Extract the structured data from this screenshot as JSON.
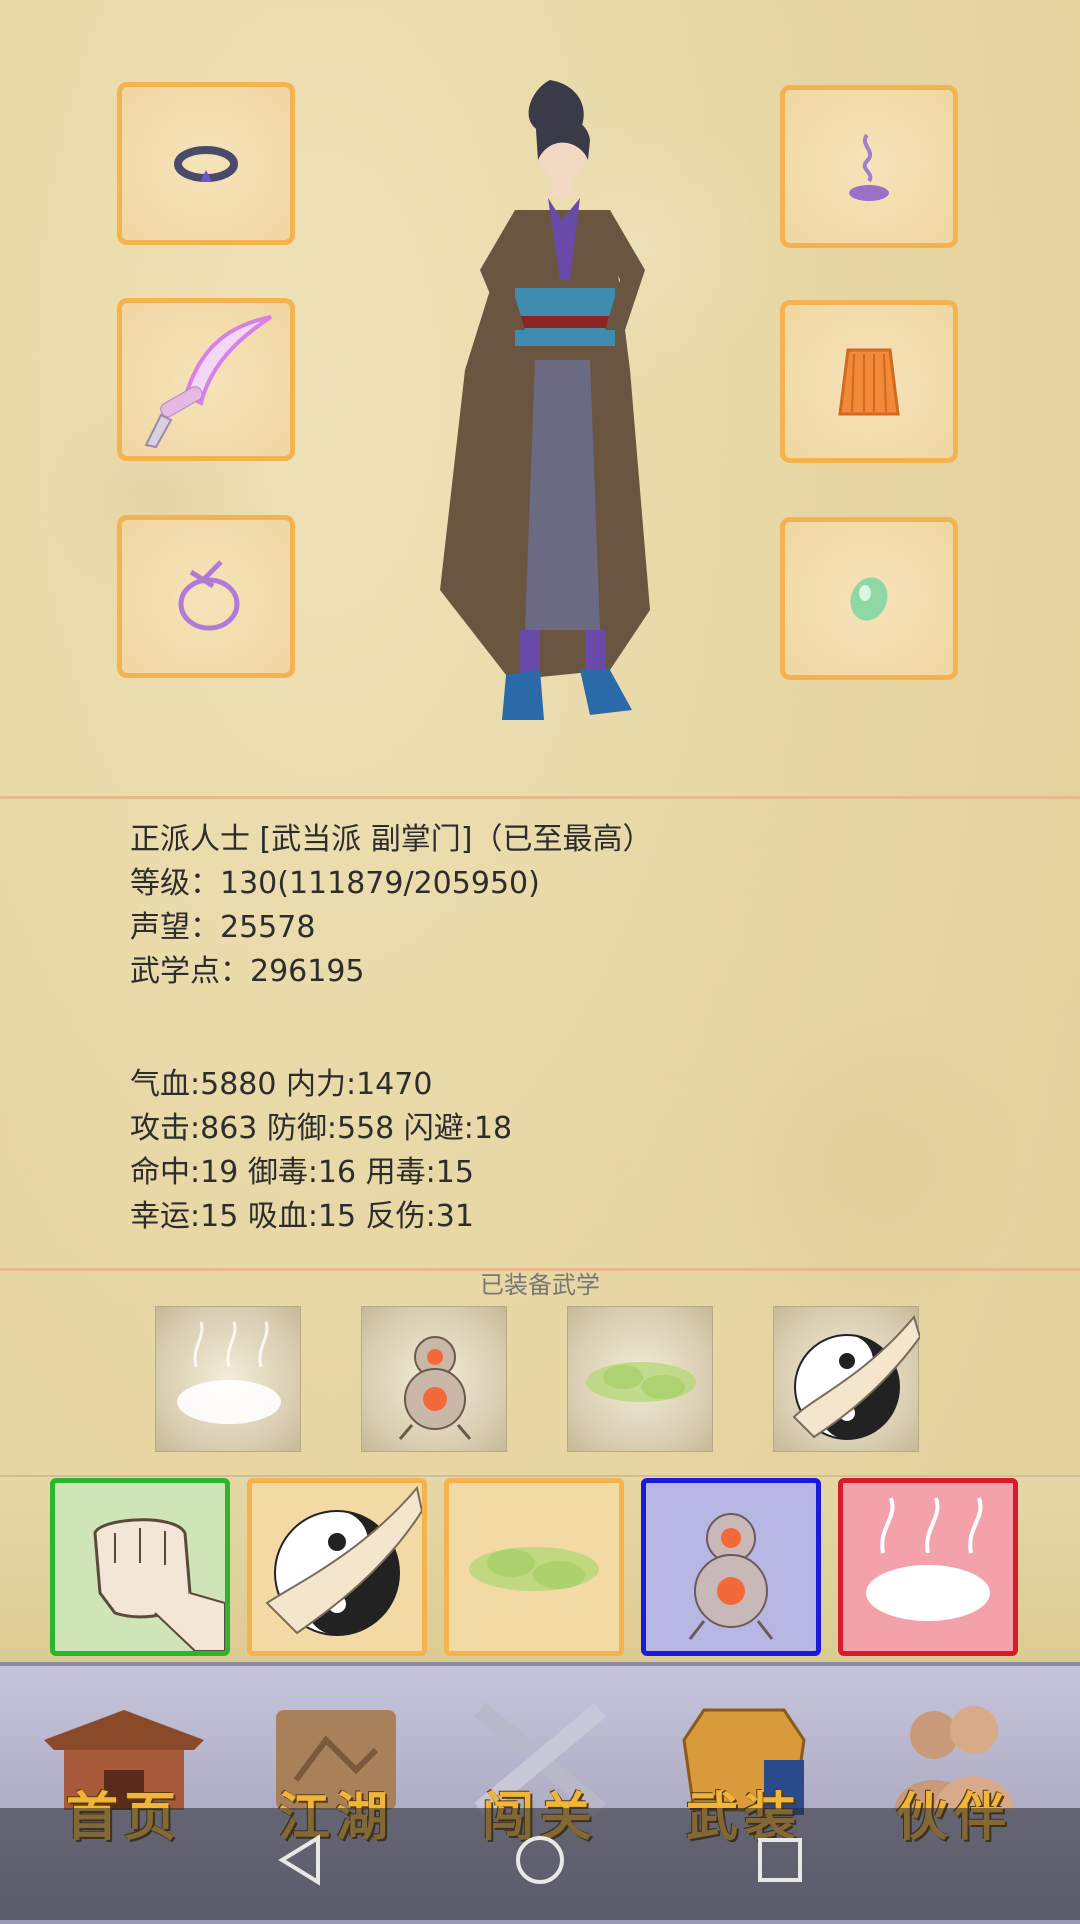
{
  "equipment_slots": {
    "left": [
      "ring",
      "curved-sword",
      "pendant"
    ],
    "right": [
      "incense",
      "skirt-armor",
      "jade"
    ]
  },
  "profile": {
    "title_line": "正派人士 [武当派 副掌门]（已至最高）",
    "level_line": "等级：130(111879/205950)",
    "reputation_line": "声望：25578",
    "martial_points_line": "武学点：296195"
  },
  "stats": {
    "line1": "气血:5880  内力:1470",
    "line2": "攻击:863  防御:558  闪避:18",
    "line3": "命中:19  御毒:16  用毒:15",
    "line4": "幸运:15  吸血:15  反伤:31"
  },
  "equipped_skills_title": "已装备武学",
  "equipped_skills": [
    "mist",
    "gourd",
    "green-cloud",
    "taiji-palm"
  ],
  "skill_cards": [
    {
      "icon": "fist",
      "border": "#2db52d"
    },
    {
      "icon": "taiji-palm",
      "border": "#f5b34f"
    },
    {
      "icon": "green-cloud",
      "border": "#f5b34f"
    },
    {
      "icon": "gourd",
      "border": "#1a1ad8"
    },
    {
      "icon": "mist",
      "border": "#d81a2a"
    }
  ],
  "nav": {
    "home": "首页",
    "jianghu": "江湖",
    "challenge": "闯关",
    "equipment": "武装",
    "partners": "伙伴"
  },
  "colors": {
    "slot_border": "#f5b34f",
    "nav_text": "#f0b63a"
  }
}
